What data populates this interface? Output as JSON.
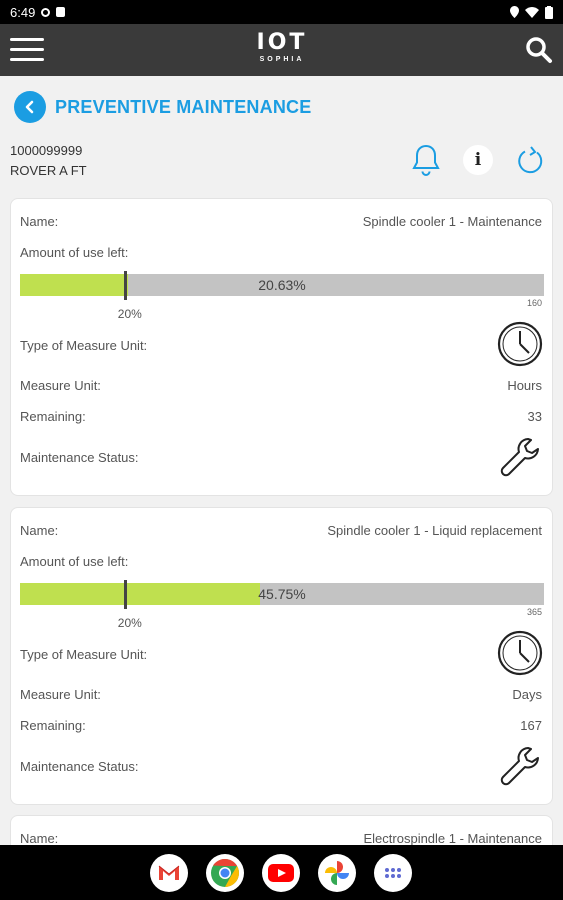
{
  "status_bar": {
    "time": "6:49"
  },
  "app_bar": {
    "logo_text": "IOT",
    "logo_subtext": "SOPHIA"
  },
  "page": {
    "title": "PREVENTIVE MAINTENANCE"
  },
  "device": {
    "id": "1000099999",
    "name": "ROVER A FT"
  },
  "labels": {
    "name": "Name:",
    "amount_left": "Amount of use left:",
    "type_unit": "Type of Measure Unit:",
    "measure_unit": "Measure Unit:",
    "remaining": "Remaining:",
    "status": "Maintenance Status:"
  },
  "cards": [
    {
      "name": "Spindle cooler 1 - Maintenance",
      "percent_text": "20.63%",
      "percent_value": 20.63,
      "marker_text": "20%",
      "marker_value": 20,
      "max_text": "160",
      "measure_type_icon": "clock-icon",
      "measure_unit": "Hours",
      "remaining": "33",
      "status_icon": "wrench-icon"
    },
    {
      "name": "Spindle cooler 1 - Liquid replacement",
      "percent_text": "45.75%",
      "percent_value": 45.75,
      "marker_text": "20%",
      "marker_value": 20,
      "max_text": "365",
      "measure_type_icon": "clock-icon",
      "measure_unit": "Days",
      "remaining": "167",
      "status_icon": "wrench-icon"
    },
    {
      "name": "Electrospindle 1 - Maintenance"
    }
  ],
  "dock": [
    "gmail-icon",
    "chrome-icon",
    "youtube-icon",
    "photos-icon",
    "apps-icon"
  ],
  "colors": {
    "accent": "#1b9de2",
    "bar_fill": "#bfe04f",
    "bar_track": "#c3c3c3",
    "appbar": "#3a3a3a"
  }
}
